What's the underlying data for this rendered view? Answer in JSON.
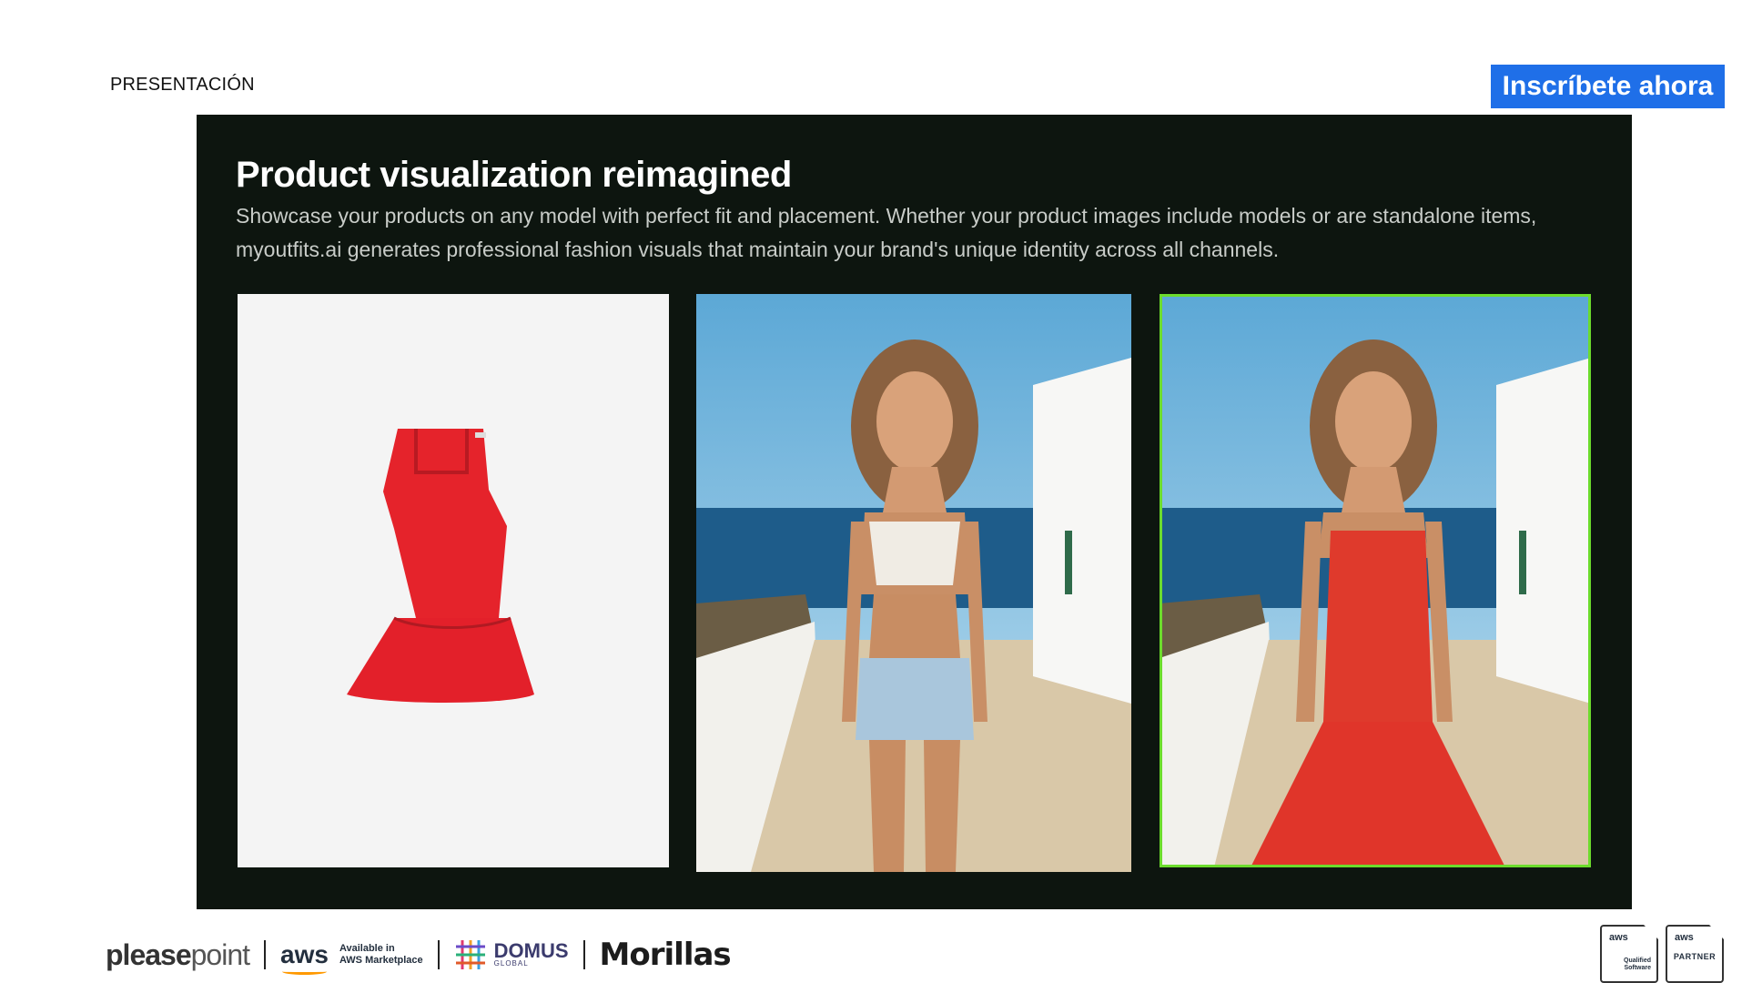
{
  "header": {
    "section_label": "PRESENTACIÓN",
    "cta_label": "Inscríbete ahora"
  },
  "slide": {
    "title": "Product visualization reimagined",
    "description": "Showcase your products on any model with perfect fit and placement. Whether your product images include models or are standalone items, myoutfits.ai generates professional fashion visuals that maintain your brand's unique identity across all channels.",
    "panels": [
      {
        "name": "product-image",
        "icon": "red-dress-image"
      },
      {
        "name": "model-original-image",
        "icon": "model-photo"
      },
      {
        "name": "model-result-image",
        "icon": "model-photo-red-dress",
        "highlight_color": "#6cdc2c"
      }
    ]
  },
  "footer": {
    "pleasepoint_bold": "please",
    "pleasepoint_light": "point",
    "aws_word": "aws",
    "aws_sub_line1": "Available in",
    "aws_sub_line2": "AWS Marketplace",
    "domus_text": "DOMUS",
    "domus_sub": "GLOBAL",
    "morillas": "Morillas"
  },
  "badges": {
    "qualified_aws": "aws",
    "qualified_line1": "Qualified",
    "qualified_line2": "Software",
    "partner_aws": "aws",
    "partner_label": "PARTNER"
  },
  "colors": {
    "cta_background": "#1f6fe8",
    "slide_background": "#0d150f",
    "highlight_border": "#6cdc2c",
    "dress_red": "#e0262c"
  }
}
